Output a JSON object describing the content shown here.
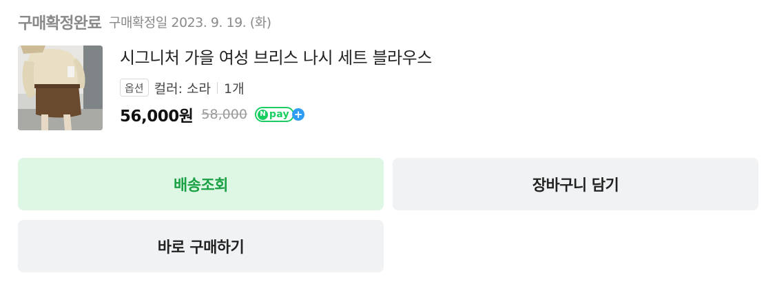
{
  "order": {
    "status_title": "구매확정완료",
    "status_date": "구매확정일 2023. 9. 19. (화)"
  },
  "product": {
    "thumbnail_icon": "product-photo",
    "title": "시그니처 가을 여성 브리스 나시 세트 블라우스",
    "option_badge": "옵션",
    "option_text": "컬러: 소라",
    "quantity": "1개",
    "price": "56,000원",
    "original_price": "58,000",
    "npay": {
      "n": "N",
      "text": "pay",
      "plus": "+"
    }
  },
  "actions": {
    "track_label": "배송조회",
    "cart_label": "장바구니 담기",
    "buy_label": "바로 구매하기"
  },
  "colors": {
    "status_gray": "#8a8a8a",
    "track_bg": "#ddf7e4",
    "track_text": "#1aa144",
    "neutral_btn_bg": "#f1f2f4",
    "npay_green": "#19ce60",
    "npay_blue": "#2f9df4"
  }
}
